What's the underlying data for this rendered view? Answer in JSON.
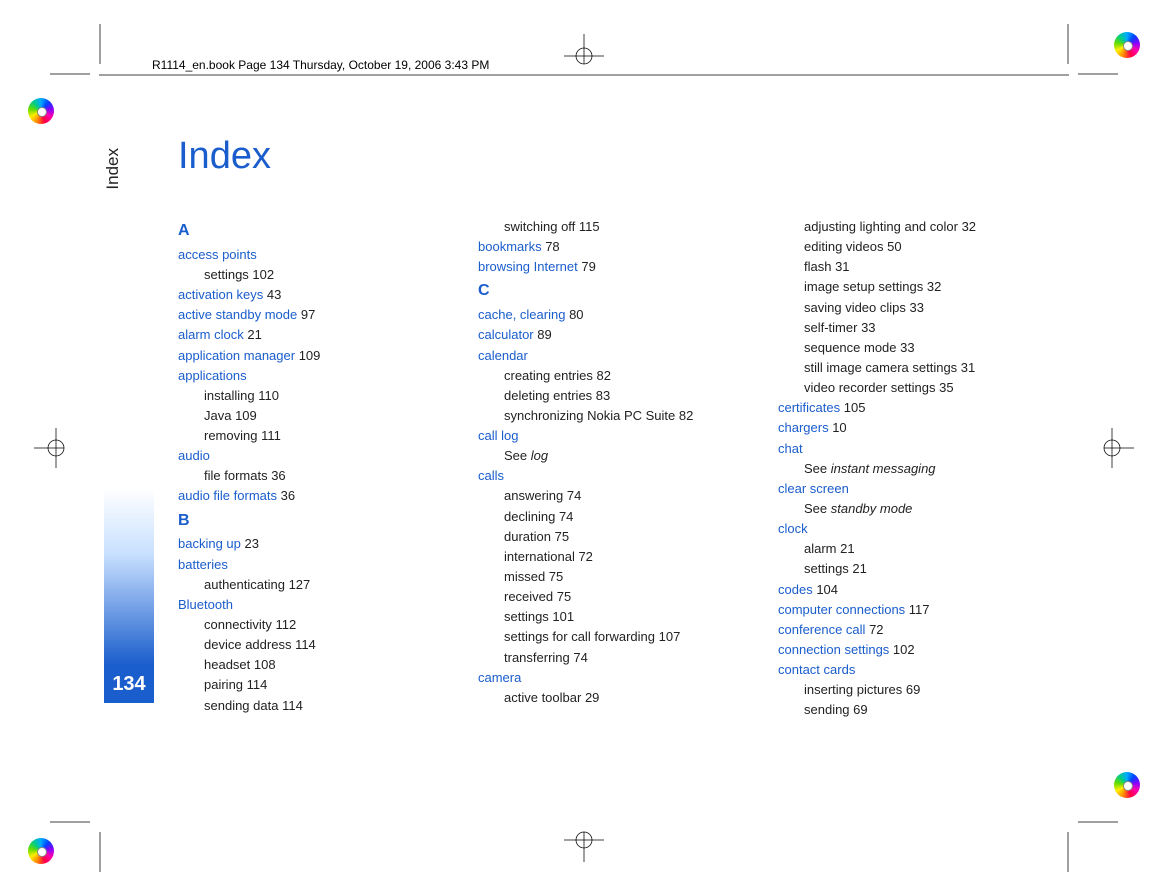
{
  "header": "R1114_en.book  Page 134  Thursday, October 19, 2006  3:43 PM",
  "sideTab": "Index",
  "pageNumber": "134",
  "title": "Index",
  "col1": {
    "A": "A",
    "access_points": "access points",
    "settings": "settings ",
    "settings_pg": "102",
    "activation_keys": "activation keys ",
    "activation_keys_pg": "43",
    "active_standby_mode": "active standby mode ",
    "active_standby_mode_pg": "97",
    "alarm_clock": "alarm clock ",
    "alarm_clock_pg": "21",
    "application_manager": "application manager ",
    "application_manager_pg": "109",
    "applications": "applications",
    "installing": "installing ",
    "installing_pg": "110",
    "java": "Java ",
    "java_pg": "109",
    "removing": "removing ",
    "removing_pg": "111",
    "audio": "audio",
    "file_formats": "file formats ",
    "file_formats_pg": "36",
    "audio_file_formats": "audio file formats ",
    "audio_file_formats_pg": "36",
    "B": "B",
    "backing_up": "backing up ",
    "backing_up_pg": "23",
    "batteries": "batteries",
    "authenticating": "authenticating ",
    "authenticating_pg": "127",
    "bluetooth": "Bluetooth",
    "connectivity": "connectivity ",
    "connectivity_pg": "112",
    "device_address": "device address ",
    "device_address_pg": "114",
    "headset": "headset ",
    "headset_pg": "108",
    "pairing": "pairing ",
    "pairing_pg": "114",
    "sending_data": "sending data ",
    "sending_data_pg": "114"
  },
  "col2": {
    "switching_off": "switching off ",
    "switching_off_pg": "115",
    "bookmarks": "bookmarks ",
    "bookmarks_pg": "78",
    "browsing_internet": "browsing Internet ",
    "browsing_internet_pg": "79",
    "C": "C",
    "cache_clearing": "cache, clearing ",
    "cache_clearing_pg": "80",
    "calculator": "calculator ",
    "calculator_pg": "89",
    "calendar": "calendar",
    "creating_entries": "creating entries ",
    "creating_entries_pg": "82",
    "deleting_entries": "deleting entries ",
    "deleting_entries_pg": "83",
    "sync_nokia": "synchronizing Nokia PC Suite ",
    "sync_nokia_pg": "82",
    "call_log": "call log",
    "see_log_pre": "See ",
    "see_log_it": "log",
    "calls": "calls",
    "answering": "answering ",
    "answering_pg": "74",
    "declining": "declining ",
    "declining_pg": "74",
    "duration": "duration ",
    "duration_pg": "75",
    "international": "international ",
    "international_pg": "72",
    "missed": "missed ",
    "missed_pg": "75",
    "received": "received ",
    "received_pg": "75",
    "settings": "settings ",
    "settings_pg": "101",
    "settings_call_fwd": "settings for call forwarding ",
    "settings_call_fwd_pg": "107",
    "transferring": "transferring ",
    "transferring_pg": "74",
    "camera": "camera",
    "active_toolbar": "active toolbar ",
    "active_toolbar_pg": "29"
  },
  "col3": {
    "adj_light": "adjusting lighting and color ",
    "adj_light_pg": "32",
    "editing_videos": "editing videos ",
    "editing_videos_pg": "50",
    "flash": "flash ",
    "flash_pg": "31",
    "image_setup": "image setup settings ",
    "image_setup_pg": "32",
    "saving_video": "saving video clips ",
    "saving_video_pg": "33",
    "self_timer": "self-timer ",
    "self_timer_pg": "33",
    "sequence_mode": "sequence mode ",
    "sequence_mode_pg": "33",
    "still_image_settings": "still image camera settings ",
    "still_image_settings_pg": "31",
    "video_rec_settings": "video recorder settings ",
    "video_rec_settings_pg": "35",
    "certificates": "certificates ",
    "certificates_pg": "105",
    "chargers": "chargers ",
    "chargers_pg": "10",
    "chat": "chat",
    "see_im_pre": "See ",
    "see_im_it": "instant messaging",
    "clear_screen": "clear screen",
    "see_standby_pre": "See ",
    "see_standby_it": "standby mode",
    "clock": "clock",
    "alarm": "alarm ",
    "alarm_pg": "21",
    "clk_settings": "settings ",
    "clk_settings_pg": "21",
    "codes": "codes ",
    "codes_pg": "104",
    "computer_conn": "computer connections ",
    "computer_conn_pg": "117",
    "conference_call": "conference call ",
    "conference_call_pg": "72",
    "connection_settings": "connection settings ",
    "connection_settings_pg": "102",
    "contact_cards": "contact cards",
    "inserting_pictures": "inserting pictures ",
    "inserting_pictures_pg": "69",
    "sending": "sending ",
    "sending_pg": "69"
  }
}
